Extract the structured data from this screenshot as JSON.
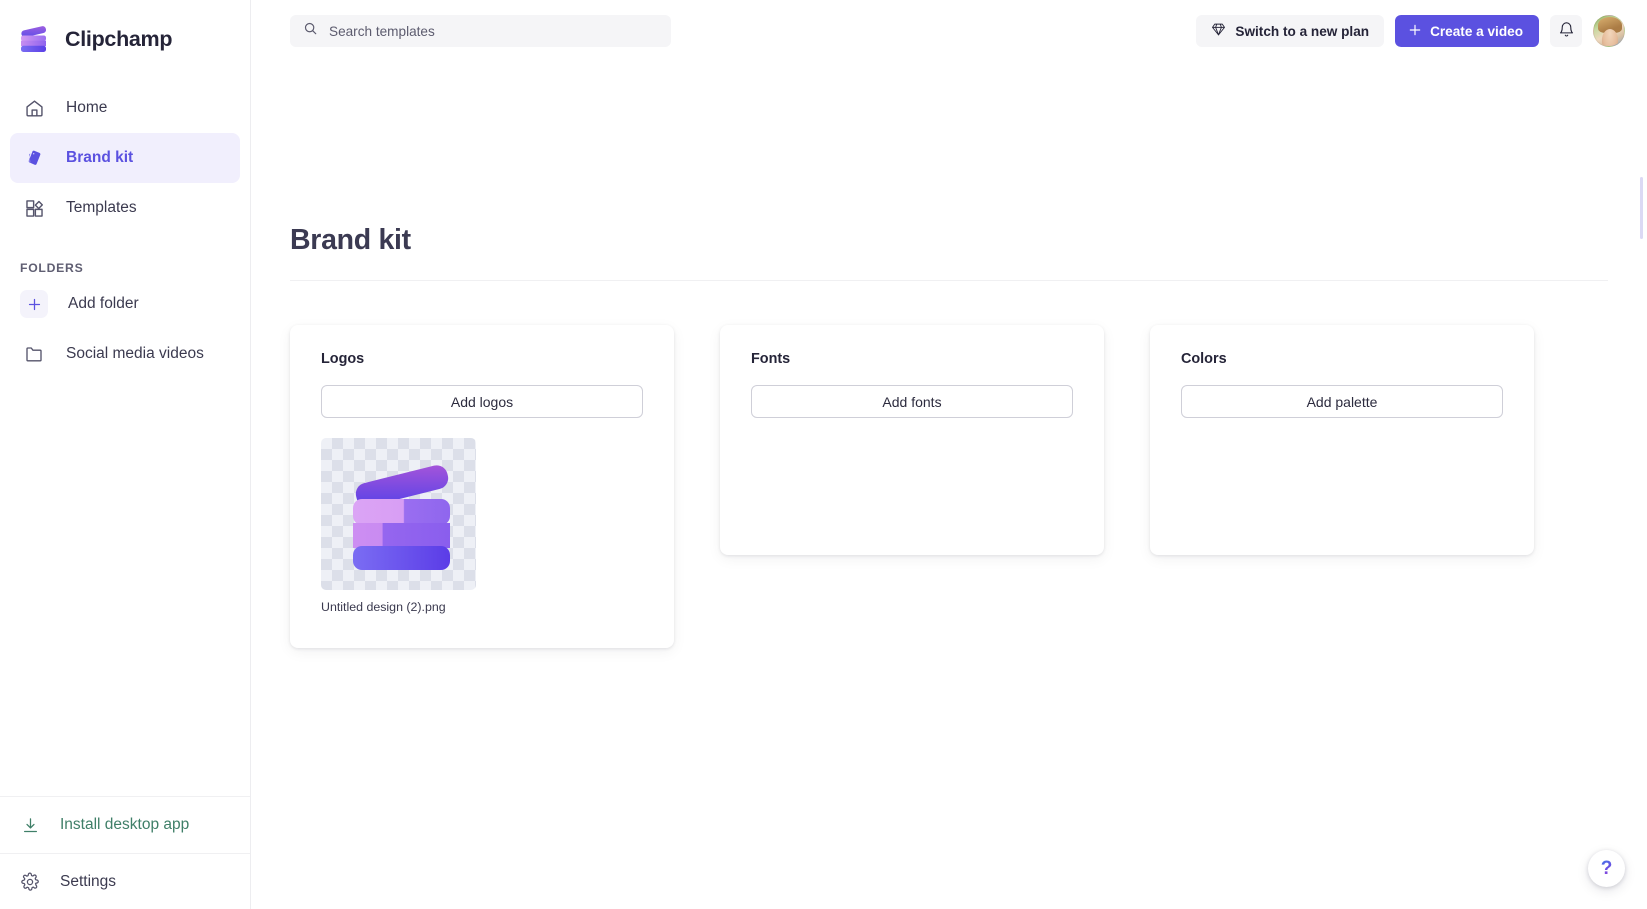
{
  "app": {
    "name": "Clipchamp",
    "logo_icon": "clapperboard-icon"
  },
  "sidebar": {
    "nav": [
      {
        "label": "Home",
        "icon": "home-icon",
        "active": false
      },
      {
        "label": "Brand kit",
        "icon": "brand-kit-tag-icon",
        "active": true
      },
      {
        "label": "Templates",
        "icon": "templates-grid-icon",
        "active": false
      }
    ],
    "folders_heading": "FOLDERS",
    "folders": [
      {
        "label": "Add folder",
        "icon": "plus-icon"
      },
      {
        "label": "Social media videos",
        "icon": "folder-icon"
      }
    ],
    "bottom": [
      {
        "label": "Install desktop app",
        "icon": "download-icon"
      },
      {
        "label": "Settings",
        "icon": "gear-icon"
      }
    ]
  },
  "topbar": {
    "search": {
      "placeholder": "Search templates",
      "value": "",
      "icon": "search-icon"
    },
    "switch_plan_label": "Switch to a new plan",
    "switch_plan_icon": "diamond-icon",
    "create_video_label": "Create a video",
    "create_video_icon": "plus-icon",
    "notifications_icon": "bell-icon",
    "avatar_icon": "user-avatar"
  },
  "main": {
    "page_title": "Brand kit",
    "cards": [
      {
        "title": "Logos",
        "button_label": "Add logos",
        "assets": [
          {
            "name": "Untitled design (2).png",
            "thumbnail": "clapperboard-logo-transparent"
          }
        ]
      },
      {
        "title": "Fonts",
        "button_label": "Add fonts",
        "assets": []
      },
      {
        "title": "Colors",
        "button_label": "Add palette",
        "assets": []
      }
    ]
  },
  "help": {
    "icon": "question-mark-icon",
    "label": "?"
  },
  "colors": {
    "accent": "#5b51e0",
    "accent_soft_bg": "#f1effd",
    "text_primary": "#252438",
    "text_secondary": "#3b3a4f",
    "install_green": "#3f7f68",
    "chip_bg": "#f5f5f7",
    "border": "#ededf0"
  }
}
